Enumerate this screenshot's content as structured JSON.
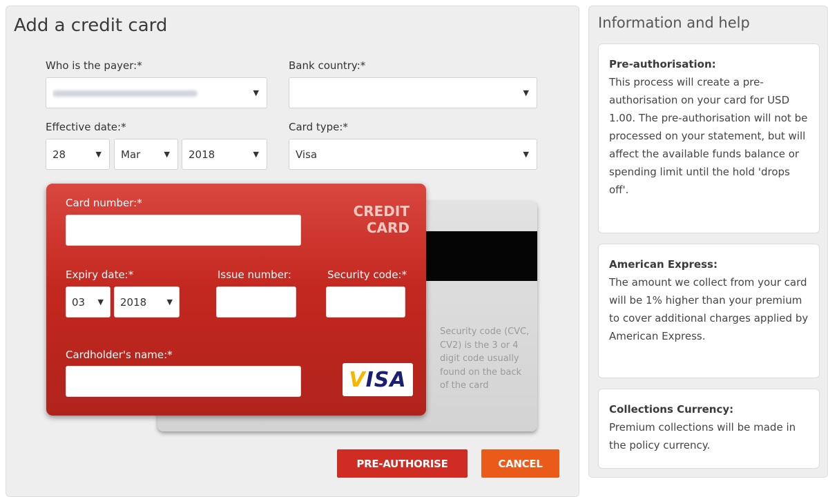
{
  "main": {
    "title": "Add a credit card",
    "payer_label": "Who is the payer:*",
    "payer_value_redacted": true,
    "bank_country_label": "Bank country:*",
    "bank_country_value": "",
    "effective_date_label": "Effective date:*",
    "effective_day": "28",
    "effective_month": "Mar",
    "effective_year": "2018",
    "card_type_label": "Card type:*",
    "card_type_value": "Visa"
  },
  "card_front": {
    "card_number_label": "Card number:*",
    "brand_text_line1": "CREDIT",
    "brand_text_line2": "CARD",
    "expiry_label": "Expiry date:*",
    "expiry_month": "03",
    "expiry_year": "2018",
    "issue_number_label": "Issue number:",
    "security_code_label": "Security code:*",
    "cardholder_label": "Cardholder's name:*",
    "visa_logo": "VISA"
  },
  "card_back": {
    "security_help": "Security code (CVC, CV2) is the 3 or 4 digit code usually found on the back of the card"
  },
  "buttons": {
    "preauthorise": "PRE-AUTHORISE",
    "cancel": "CANCEL"
  },
  "help": {
    "title": "Information and help",
    "boxes": [
      {
        "title": "Pre-authorisation:",
        "body": "This process will create a pre-authorisation on your card for USD 1.00. The pre-authorisation will not be processed on your statement, but will affect the available funds balance or spending limit until the hold 'drops off'."
      },
      {
        "title": "American Express:",
        "body": "The amount we collect from your card will be 1% higher than your premium to cover additional charges applied by American Express."
      },
      {
        "title": "Collections Currency:",
        "body": "Premium collections will be made in the policy currency."
      }
    ]
  },
  "icons": {
    "dropdown_arrow": "▼"
  },
  "colors": {
    "card_red": "#c3281f",
    "preauth_button": "#cf2c24",
    "cancel_button": "#ea5a18",
    "visa_blue": "#1a1f71"
  }
}
